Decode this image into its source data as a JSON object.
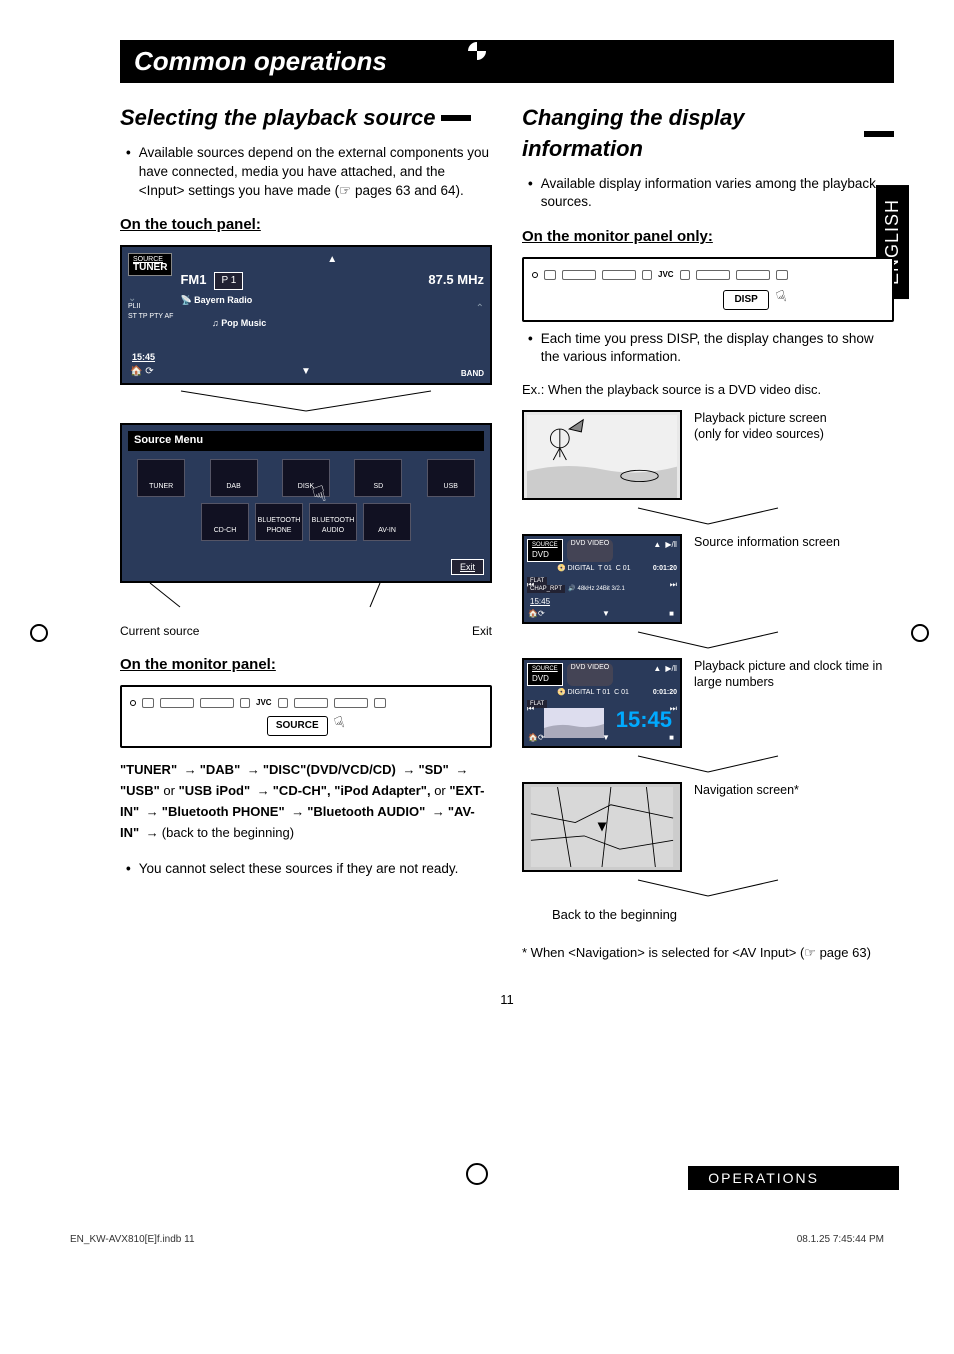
{
  "pageTitle": "Common operations",
  "languageTab": "ENGLISH",
  "left": {
    "heading": "Selecting the playback source",
    "introBullet": "Available sources depend on the external components you have connected, media you have attached, and the <Input> settings you have made (☞ pages 63 and 64).",
    "touchPanelHeading": "On the touch panel:",
    "tuner": {
      "sourceLabel": "SOURCE",
      "sourceValue": "TUNER",
      "band": "FM1",
      "preset": "P 1",
      "freq": "87.5  MHz",
      "station": "Bayern Radio",
      "indicators": "ST  TP  PTY  AF",
      "genre": "Pop Music",
      "time": "15:45",
      "bandBtn": "BAND"
    },
    "sourceMenu": {
      "title": "Source Menu",
      "row1": [
        "TUNER",
        "DAB",
        "DISK",
        "SD",
        "USB"
      ],
      "row2": [
        "CD-CH",
        "BLUETOOTH PHONE",
        "BLUETOOTH AUDIO",
        "AV-IN"
      ],
      "exit": "Exit"
    },
    "callouts": {
      "left": "Current source",
      "right": "Exit"
    },
    "monitorHeading": "On the monitor panel:",
    "monitorBrand": "JVC",
    "sourceButton": "SOURCE",
    "sequence": {
      "parts": [
        {
          "b": "\"TUNER\""
        },
        {
          "a": true
        },
        {
          "b": "\"DAB\""
        },
        {
          "a": true
        },
        {
          "b": "\"DISC\"(DVD/VCD/CD)"
        },
        {
          "a": true
        },
        {
          "b": "\"SD\""
        },
        {
          "a": true
        },
        {
          "b": "\"USB\""
        },
        {
          "t": " or "
        },
        {
          "b": "\"USB iPod\""
        },
        {
          "a": true
        },
        {
          "b": "\"CD-CH\", \"iPod Adapter\","
        },
        {
          "t": " or "
        },
        {
          "b": "\"EXT-IN\""
        },
        {
          "a": true
        },
        {
          "b": "\"Bluetooth PHONE\""
        },
        {
          "a": true
        },
        {
          "b": "\"Bluetooth AUDIO\""
        },
        {
          "a": true
        },
        {
          "b": "\"AV-IN\""
        },
        {
          "a": true
        },
        {
          "t": "(back to the beginning)"
        }
      ]
    },
    "noteBullet": "You cannot select these sources if they are not ready."
  },
  "right": {
    "heading": "Changing the display information",
    "introBullet": "Available display information varies among the playback sources.",
    "monitorHeading": "On the monitor panel only:",
    "monitorBrand": "JVC",
    "dispButton": "DISP",
    "dispNote": "Each time you press DISP, the display changes to show the various information.",
    "example": "Ex.: When the playback source is a DVD video disc.",
    "screens": [
      {
        "desc": "Playback picture screen\n(only for video sources)"
      },
      {
        "desc": "Source information screen",
        "info": {
          "src": "DVD",
          "t": "T 01",
          "c": "C 01",
          "time": "0:01:20",
          "audio": "48kHz  24Bit  3/2.1",
          "clock": "15:45"
        }
      },
      {
        "desc": "Playback picture and clock time in large numbers",
        "info": {
          "src": "DVD",
          "t": "T 01",
          "c": "C 01",
          "time": "0:01:20",
          "big": "15:45"
        }
      },
      {
        "desc": "Navigation screen*"
      }
    ],
    "backTo": "Back to the beginning",
    "footnote": "*  When <Navigation> is selected for <AV Input> (☞ page 63)"
  },
  "pageNumber": "11",
  "footerStrip": "OPERATIONS",
  "printFooter": {
    "left": "EN_KW-AVX810[E]f.indb   11",
    "right": "08.1.25   7:45:44 PM"
  }
}
